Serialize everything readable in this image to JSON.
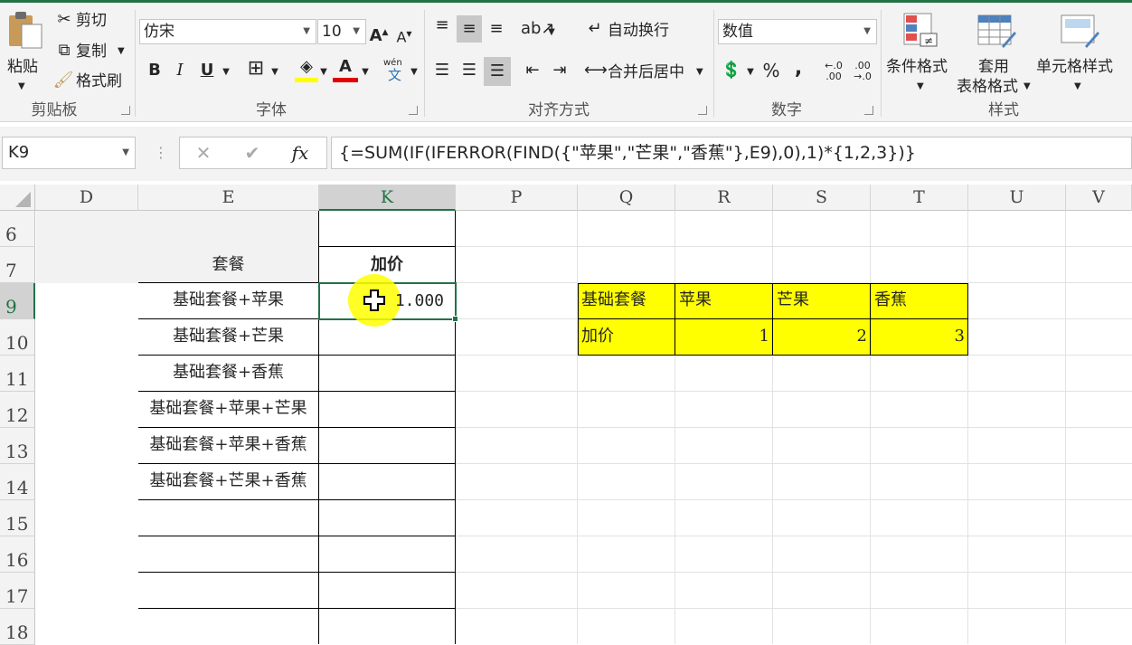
{
  "ribbon": {
    "clipboard": {
      "paste": "粘贴",
      "cut": "剪切",
      "copy": "复制",
      "format_painter": "格式刷",
      "group_label": "剪贴板"
    },
    "font": {
      "font_name": "仿宋",
      "font_size": "10",
      "bold": "B",
      "italic": "I",
      "underline": "U",
      "phonetic_top": "wén",
      "phonetic_bottom": "文",
      "group_label": "字体"
    },
    "alignment": {
      "wrap_text": "自动换行",
      "merge_center": "合并后居中",
      "group_label": "对齐方式"
    },
    "number": {
      "format": "数值",
      "percent": "%",
      "comma": ",",
      "inc_decimal": "←.0 .00",
      "dec_decimal": ".00 →.0",
      "group_label": "数字"
    },
    "styles": {
      "conditional": "条件格式",
      "table_line1": "套用",
      "table_line2": "表格格式",
      "cell_styles": "单元格样式",
      "group_label": "样式"
    }
  },
  "formula_bar": {
    "name_box": "K9",
    "formula": "{=SUM(IF(IFERROR(FIND({\"苹果\",\"芒果\",\"香蕉\"},E9),0),1)*{1,2,3})}"
  },
  "sheet": {
    "columns": [
      "D",
      "E",
      "K",
      "P",
      "Q",
      "R",
      "S",
      "T",
      "U",
      "V"
    ],
    "rows": [
      "6",
      "7",
      "9",
      "10",
      "11",
      "12",
      "13",
      "14",
      "15",
      "16",
      "17",
      "18"
    ],
    "header_e": "套餐",
    "header_k": "加价",
    "e_values": [
      "基础套餐+苹果",
      "基础套餐+芒果",
      "基础套餐+香蕉",
      "基础套餐+苹果+芒果",
      "基础套餐+苹果+香蕉",
      "基础套餐+芒果+香蕉"
    ],
    "k9_value": "1.000",
    "lookup": {
      "q9": "基础套餐",
      "r9": "苹果",
      "s9": "芒果",
      "t9": "香蕉",
      "q10": "加价",
      "r10": "1",
      "s10": "2",
      "t10": "3"
    }
  },
  "colors": {
    "accent": "#217346",
    "highlight": "#ffff00",
    "cursor_halo": "#ffff00"
  }
}
